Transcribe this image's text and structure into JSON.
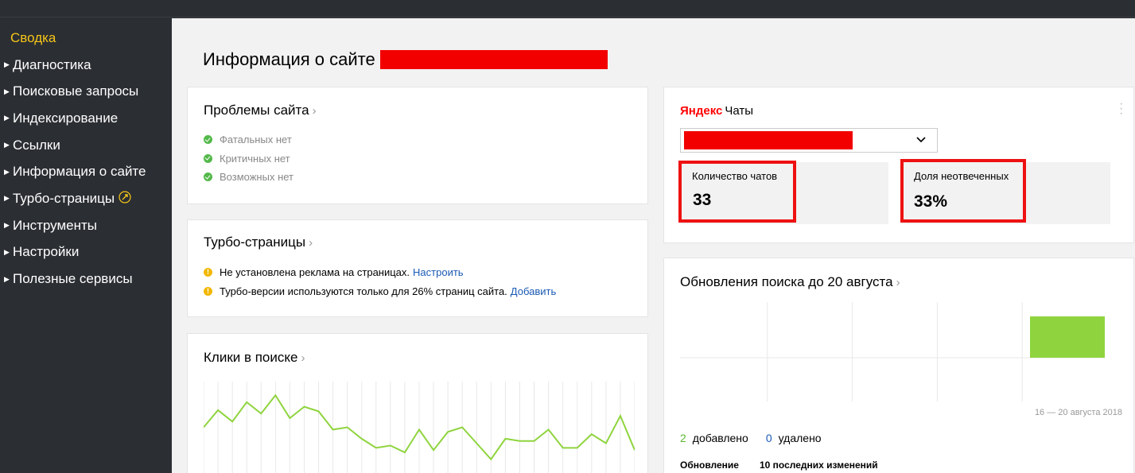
{
  "sidebar": {
    "items": [
      {
        "label": "Сводка",
        "active": true
      },
      {
        "label": "Диагностика"
      },
      {
        "label": "Поисковые запросы"
      },
      {
        "label": "Индексирование"
      },
      {
        "label": "Ссылки"
      },
      {
        "label": "Информация о сайте"
      },
      {
        "label": "Турбо-страницы"
      },
      {
        "label": "Инструменты"
      },
      {
        "label": "Настройки"
      },
      {
        "label": "Полезные сервисы"
      }
    ]
  },
  "page": {
    "title": "Информация о сайте"
  },
  "problems": {
    "title": "Проблемы сайта",
    "items": [
      "Фатальных нет",
      "Критичных нет",
      "Возможных нет"
    ]
  },
  "turbo": {
    "title": "Турбо-страницы",
    "warnings": [
      {
        "text": "Не установлена реклама на страницах.",
        "link": "Настроить"
      },
      {
        "text": "Турбо-версии используются только для 26% страниц сайта.",
        "link": "Добавить"
      }
    ]
  },
  "clicks": {
    "title": "Клики в поиске",
    "series": [
      40,
      55,
      45,
      62,
      52,
      68,
      48,
      58,
      54,
      38,
      40,
      30,
      22,
      24,
      18,
      38,
      20,
      36,
      40,
      26,
      12,
      30,
      28,
      28,
      38,
      22,
      22,
      34,
      26,
      50,
      20
    ]
  },
  "chats": {
    "logo_yandex": "Яндекс",
    "logo_chats": "Чаты",
    "stat1_label": "Количество чатов",
    "stat1_value": "33",
    "stat2_label": "Доля неотвеченных",
    "stat2_value": "33%"
  },
  "updates": {
    "title": "Обновления поиска до 20 августа",
    "date_range": "16 — 20 августа 2018",
    "added_count": "2",
    "added_label": "добавлено",
    "removed_count": "0",
    "removed_label": "удалено",
    "col1": "Обновление",
    "col2": "10 последних изменений",
    "bar_value": 2,
    "bar_color": "#8fd43e"
  },
  "colors": {
    "sidebar_bg": "#2b2e33",
    "active": "#f5c518",
    "link": "#1a5ab4",
    "chart_line": "#8fd43e",
    "highlight": "#ee1111"
  }
}
